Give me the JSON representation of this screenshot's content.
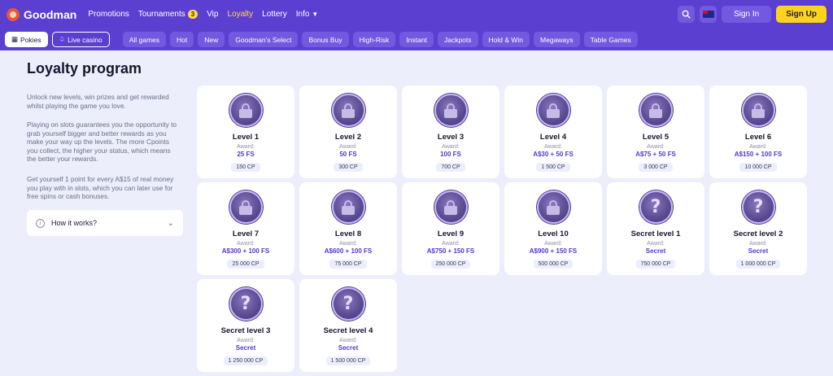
{
  "brand": {
    "name": "Goodman"
  },
  "topnav": [
    {
      "label": "Promotions",
      "active": false
    },
    {
      "label": "Tournaments",
      "badge": "3",
      "active": false
    },
    {
      "label": "Vip",
      "active": false
    },
    {
      "label": "Loyalty",
      "active": true
    },
    {
      "label": "Lottery",
      "active": false
    },
    {
      "label": "Info",
      "active": false
    }
  ],
  "header": {
    "signin": "Sign In",
    "signup": "Sign Up"
  },
  "categories": [
    "Pokies",
    "Live casino",
    "All games",
    "Hot",
    "New",
    "Goodman's Select",
    "Bonus Buy",
    "High-Risk",
    "Instant",
    "Jackpots",
    "Hold & Win",
    "Megaways",
    "Table Games"
  ],
  "page": {
    "title": "Loyalty program",
    "paragraphs": [
      "Unlock new levels, win prizes and get rewarded whilst playing the game you love.",
      "Playing on slots guarantees you the opportunity to grab yourself bigger and better rewards as you make your way up the levels. The more Cpoints you collect, the higher your status, which means the better your rewards.",
      "Get yourself 1 point for every A$15 of real money you play with in slots, which you can later use for free spins or cash bonuses."
    ],
    "how_it_works": "How it works?"
  },
  "award_label": "Award:",
  "levels": [
    {
      "name": "Level 1",
      "award": "25 FS",
      "cp": "150 CP",
      "icon": "lock"
    },
    {
      "name": "Level 2",
      "award": "50 FS",
      "cp": "300 CP",
      "icon": "lock"
    },
    {
      "name": "Level 3",
      "award": "100 FS",
      "cp": "700 CP",
      "icon": "lock"
    },
    {
      "name": "Level 4",
      "award": "A$30 + 50 FS",
      "cp": "1 500 CP",
      "icon": "lock"
    },
    {
      "name": "Level 5",
      "award": "A$75 + 50 FS",
      "cp": "3 000 CP",
      "icon": "lock"
    },
    {
      "name": "Level 6",
      "award": "A$150 + 100 FS",
      "cp": "10 000 CP",
      "icon": "lock"
    },
    {
      "name": "Level 7",
      "award": "A$300 + 100 FS",
      "cp": "25 000 CP",
      "icon": "lock"
    },
    {
      "name": "Level 8",
      "award": "A$600 + 100 FS",
      "cp": "75 000 CP",
      "icon": "lock"
    },
    {
      "name": "Level 9",
      "award": "A$750 + 150 FS",
      "cp": "250 000 CP",
      "icon": "lock"
    },
    {
      "name": "Level 10",
      "award": "A$900 + 150 FS",
      "cp": "500 000 CP",
      "icon": "lock"
    },
    {
      "name": "Secret level 1",
      "award": "Secret",
      "cp": "750 000 CP",
      "icon": "question"
    },
    {
      "name": "Secret level 2",
      "award": "Secret",
      "cp": "1 000 000 CP",
      "icon": "question"
    },
    {
      "name": "Secret level 3",
      "award": "Secret",
      "cp": "1 250 000 CP",
      "icon": "question"
    },
    {
      "name": "Secret level 4",
      "award": "Secret",
      "cp": "1 500 000 CP",
      "icon": "question"
    }
  ]
}
